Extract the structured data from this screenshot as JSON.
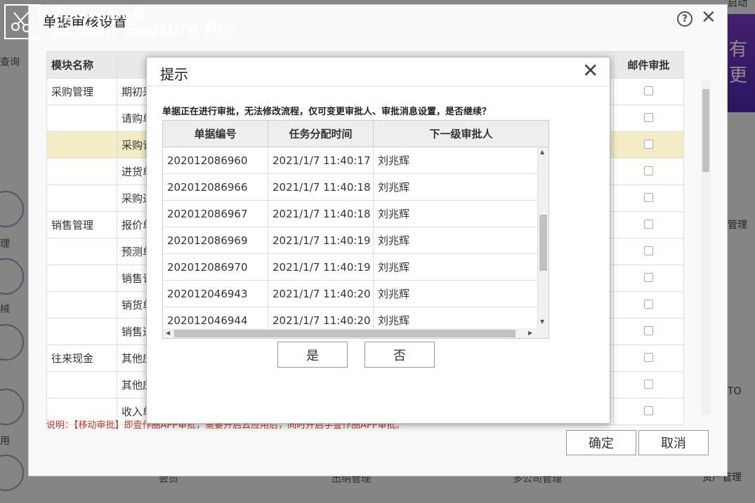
{
  "background": {
    "left_items": [
      "查询",
      "理",
      "械",
      "用"
    ],
    "right_banner": "有更",
    "right_top": "启动",
    "right_items": [
      "管理",
      "TO",
      "资产管理"
    ],
    "bottom_items": [
      "会员",
      "出纳管理",
      "多公司管理"
    ]
  },
  "outer_dialog": {
    "title": "单据审核设置",
    "help_icon": "?",
    "close_icon": "✕",
    "columns": {
      "module": "模块名称",
      "email": "邮件审批"
    },
    "rows": [
      {
        "module": "采购管理",
        "item": "期初采",
        "hl": false
      },
      {
        "module": "",
        "item": "请购单",
        "hl": false
      },
      {
        "module": "",
        "item": "采购订",
        "hl": true
      },
      {
        "module": "",
        "item": "进货单",
        "hl": false
      },
      {
        "module": "",
        "item": "采购退",
        "hl": false
      },
      {
        "module": "销售管理",
        "item": "报价单",
        "hl": false
      },
      {
        "module": "",
        "item": "预测单",
        "hl": false
      },
      {
        "module": "",
        "item": "销售订",
        "hl": false
      },
      {
        "module": "",
        "item": "销货单",
        "hl": false
      },
      {
        "module": "",
        "item": "销售退",
        "hl": false
      },
      {
        "module": "往来现金",
        "item": "其他应",
        "hl": false
      },
      {
        "module": "",
        "item": "其他应",
        "hl": false
      },
      {
        "module": "",
        "item": "收入单",
        "hl": false
      }
    ],
    "note": "说明：【移动审批】即壹作圈APP审批，需要开启云应用后，同时开启手壹作圈APP审批。",
    "confirm_label": "确定",
    "cancel_label": "取消"
  },
  "modal": {
    "title": "提示",
    "close_icon": "✕",
    "message": "单据正在进行审批，无法修改流程，仅可变更审批人、审批消息设置，是否继续？",
    "columns": [
      "单据编号",
      "任务分配时间",
      "下一级审批人"
    ],
    "rows": [
      [
        "202012086960",
        "2021/1/7 11:40:17",
        "刘兆辉"
      ],
      [
        "202012086966",
        "2021/1/7 11:40:18",
        "刘兆辉"
      ],
      [
        "202012086967",
        "2021/1/7 11:40:18",
        "刘兆辉"
      ],
      [
        "202012086969",
        "2021/1/7 11:40:19",
        "刘兆辉"
      ],
      [
        "202012086970",
        "2021/1/7 11:40:19",
        "刘兆辉"
      ],
      [
        "202012046943",
        "2021/1/7 11:40:20",
        "刘兆辉"
      ],
      [
        "202012046944",
        "2021/1/7 11:40:20",
        "刘兆辉"
      ]
    ],
    "yes_label": "是",
    "no_label": "否"
  },
  "watermark": {
    "line1": "Apowersoft",
    "line2": "Screen Capture Pro"
  }
}
